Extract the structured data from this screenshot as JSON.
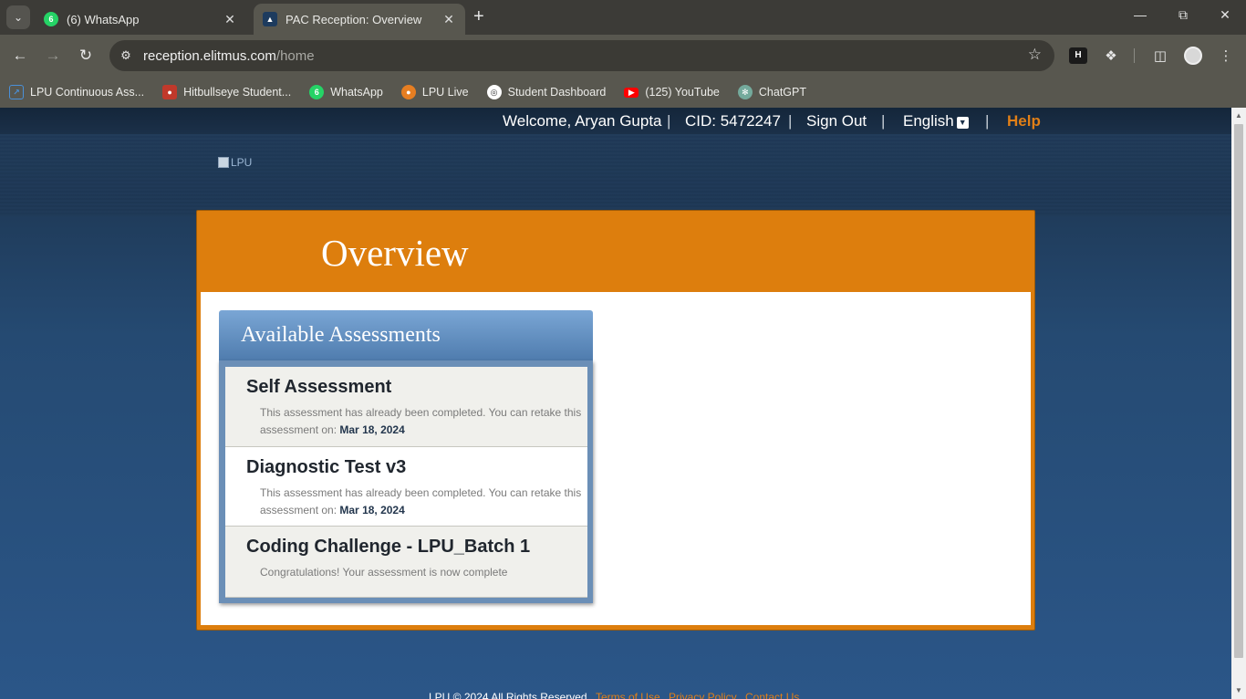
{
  "browser": {
    "tabs": [
      {
        "title": "(6) WhatsApp",
        "favicon_badge": "6",
        "active": false
      },
      {
        "title": "PAC Reception: Overview",
        "active": true
      }
    ],
    "address": {
      "domain": "reception.elitmus.com",
      "path": "/home"
    },
    "bookmarks": [
      {
        "label": "LPU Continuous Ass...",
        "icon": "external-link-icon",
        "color": "#4a90d9"
      },
      {
        "label": "Hitbullseye Student...",
        "icon": "hitbullseye-icon",
        "color": "#c0392b"
      },
      {
        "label": "WhatsApp",
        "icon": "whatsapp-icon",
        "color": "#25d366",
        "badge": "6"
      },
      {
        "label": "LPU Live",
        "icon": "lpu-live-icon",
        "color": "#e67e22"
      },
      {
        "label": "Student Dashboard",
        "icon": "globe-icon",
        "color": "#ffffff"
      },
      {
        "label": "(125) YouTube",
        "icon": "youtube-icon",
        "color": "#ff0000"
      },
      {
        "label": "ChatGPT",
        "icon": "chatgpt-icon",
        "color": "#74aa9c"
      }
    ]
  },
  "topbar": {
    "welcome": "Welcome,",
    "user": "Aryan Gupta",
    "cid": "CID: 5472247",
    "sign_out": "Sign Out",
    "language": "English",
    "help": "Help"
  },
  "logo_alt": "LPU",
  "page_title": "Overview",
  "assessments": {
    "heading": "Available Assessments",
    "items": [
      {
        "name": "Self Assessment",
        "desc": "This assessment has already been completed. You can retake this assessment on:",
        "date": "Mar 18, 2024"
      },
      {
        "name": "Diagnostic Test v3",
        "desc": "This assessment has already been completed. You can retake this assessment on:",
        "date": "Mar 18, 2024"
      },
      {
        "name": "Coding Challenge - LPU_Batch 1",
        "desc": "Congratulations! Your assessment is now complete",
        "date": ""
      }
    ]
  },
  "footer": {
    "copyright": "LPU © 2024 All Rights Reserved",
    "links": [
      "Terms of Use",
      "Privacy Policy",
      "Contact Us"
    ]
  },
  "colors": {
    "accent": "#dd7e0d",
    "header_bar": "#1b3049",
    "assess_head": "#5a87bb"
  }
}
